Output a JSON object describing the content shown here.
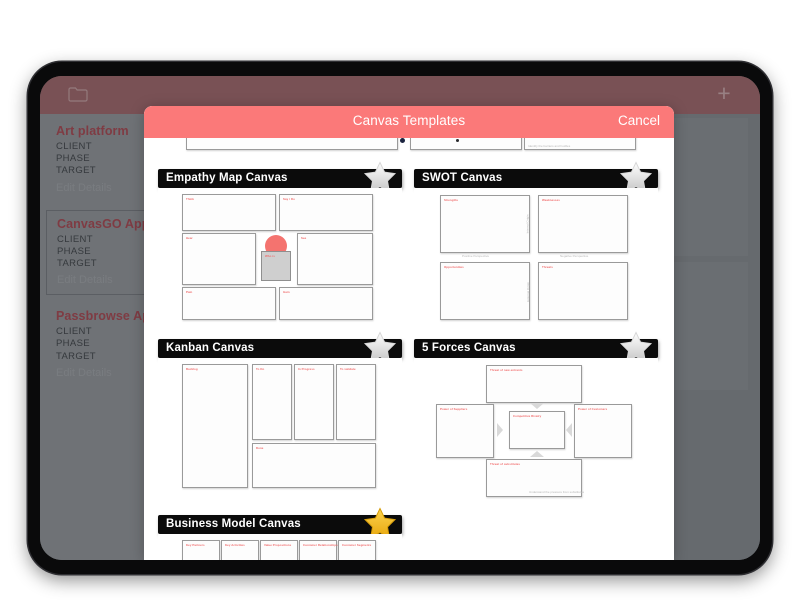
{
  "background_app": {
    "navbar": {
      "folder_icon": "folder-icon",
      "add_icon": "plus-icon"
    },
    "projects": [
      {
        "title": "Art platform",
        "client": "CLIENT",
        "phase": "PHASE",
        "target": "TARGET",
        "edit": "Edit Details",
        "selected": false
      },
      {
        "title": "CanvasGO App",
        "client": "CLIENT",
        "phase": "PHASE",
        "target": "TARGET",
        "edit": "Edit Details",
        "selected": true
      },
      {
        "title": "Passbrowse App",
        "client": "CLIENT",
        "phase": "PHASE",
        "target": "TARGET",
        "edit": "Edit Details",
        "selected": false
      }
    ]
  },
  "modal": {
    "title": "Canvas Templates",
    "cancel_label": "Cancel",
    "header_color": "#FB7979",
    "star_filled_color": "#F2B31E",
    "star_empty_color": "#FFFFFF"
  },
  "templates": [
    {
      "name": "Empathy Map Canvas",
      "favorited": false,
      "star_icon": "star-outline-icon",
      "boxes": [
        "Think",
        "Say / Do",
        "Hear",
        "See",
        "Who is",
        "Pain",
        "Gain"
      ]
    },
    {
      "name": "SWOT Canvas",
      "favorited": false,
      "star_icon": "star-outline-icon",
      "boxes": [
        "Strengths",
        "Weaknesses",
        "Opportunities",
        "Threats"
      ],
      "axis_labels": [
        "Positive Perspective",
        "Negative Perspective",
        "Internal Origin",
        "External Origin"
      ]
    },
    {
      "name": "Kanban Canvas",
      "favorited": false,
      "star_icon": "star-outline-icon",
      "boxes": [
        "Backlog",
        "To Do",
        "In Progress",
        "To validate",
        "Done"
      ]
    },
    {
      "name": "5 Forces Canvas",
      "favorited": false,
      "star_icon": "star-outline-icon",
      "boxes": [
        "Threat of new entrants",
        "Power of Suppliers",
        "Competitive Rivalry",
        "Power of Customers",
        "Threat of substitutes"
      ]
    },
    {
      "name": "Business Model Canvas",
      "favorited": true,
      "star_icon": "star-filled-icon",
      "boxes": [
        "Key Partners",
        "Key Activities",
        "Value Propositions",
        "Customer Relationships",
        "Customer Segments"
      ]
    }
  ]
}
